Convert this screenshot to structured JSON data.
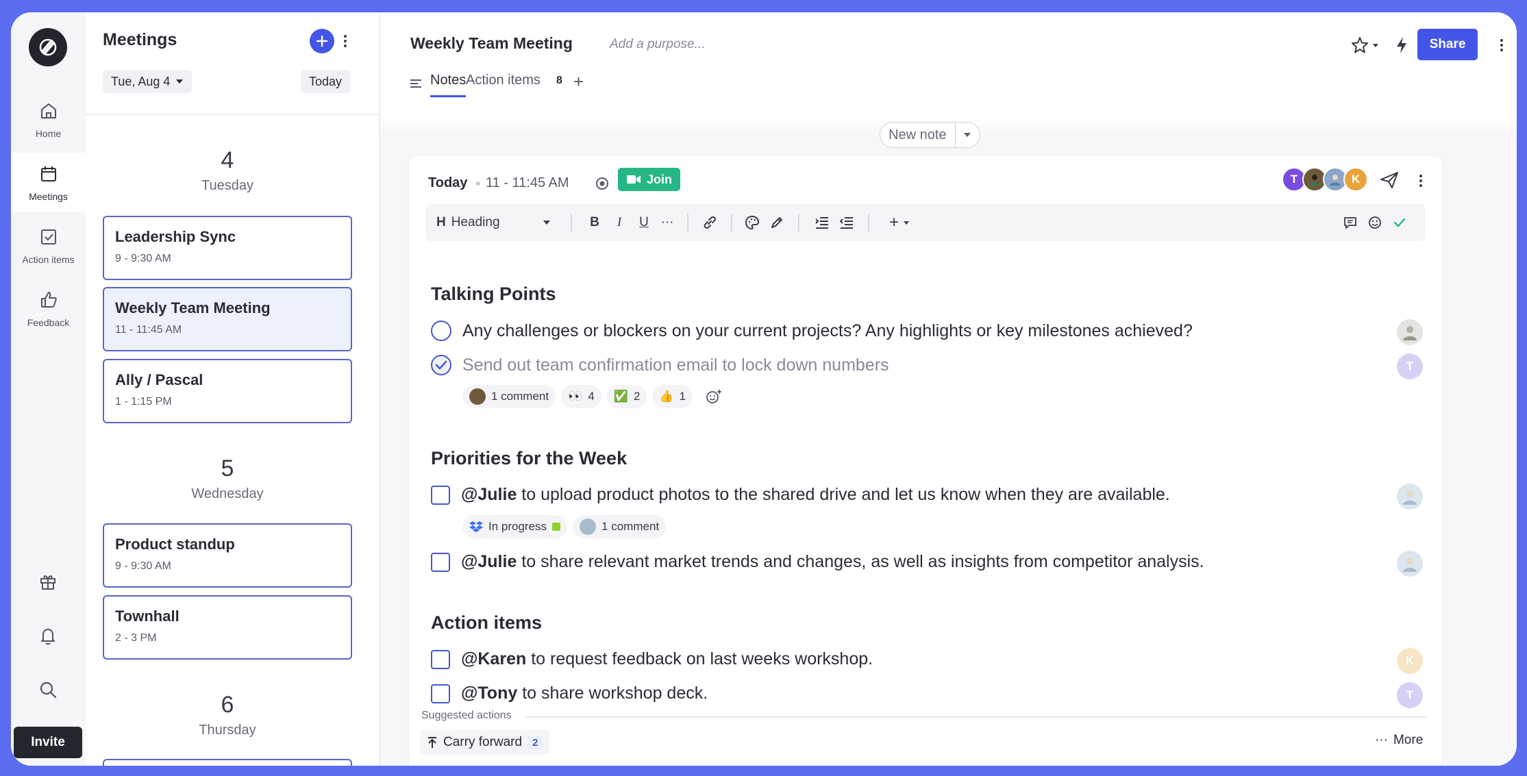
{
  "rail": {
    "items": [
      {
        "label": "Home",
        "icon": "home-icon"
      },
      {
        "label": "Meetings",
        "icon": "calendar-icon"
      },
      {
        "label": "Action items",
        "icon": "checkbox-icon"
      },
      {
        "label": "Feedback",
        "icon": "thumbs-up-icon"
      }
    ],
    "invite_label": "Invite"
  },
  "list": {
    "title": "Meetings",
    "date_label": "Tue, Aug 4",
    "today_label": "Today",
    "days": [
      {
        "num": "4",
        "name": "Tuesday"
      },
      {
        "num": "5",
        "name": "Wednesday"
      },
      {
        "num": "6",
        "name": "Thursday"
      }
    ],
    "meetings": [
      {
        "title": "Leadership Sync",
        "time": "9 - 9:30 AM"
      },
      {
        "title": "Weekly Team Meeting",
        "time": "11 - 11:45 AM"
      },
      {
        "title": "Ally / Pascal",
        "time": "1 - 1:15 PM"
      },
      {
        "title": "Product standup",
        "time": "9 - 9:30 AM"
      },
      {
        "title": "Townhall",
        "time": "2 - 3 PM"
      }
    ]
  },
  "header": {
    "title": "Weekly Team Meeting",
    "purpose_placeholder": "Add a purpose...",
    "share_label": "Share",
    "tabs": [
      {
        "label": "Notes"
      },
      {
        "label": "Action items",
        "count": "8"
      }
    ],
    "add_tab": "+"
  },
  "new_note_label": "New note",
  "note": {
    "day": "Today",
    "time": "11 - 11:45 AM",
    "join_label": "Join",
    "attendees": [
      {
        "initial": "T",
        "color": "#7b4ce0"
      },
      {
        "initial": "",
        "color": "#6e5a3a"
      },
      {
        "initial": "",
        "color": "#8aa6c8"
      },
      {
        "initial": "K",
        "color": "#e8a33a"
      }
    ],
    "toolbar": {
      "heading_label": "Heading"
    },
    "sections": [
      {
        "title": "Talking Points"
      },
      {
        "title": "Priorities for the Week"
      },
      {
        "title": "Action items"
      }
    ],
    "items": {
      "tp1": "Any challenges or blockers on your current projects? Any highlights or key milestones achieved?",
      "tp2": "Send out team confirmation email to lock down numbers",
      "tp2_comments": "1 comment",
      "tp2_reactions": [
        {
          "emoji": "👀",
          "count": "4"
        },
        {
          "emoji": "✅",
          "count": "2"
        },
        {
          "emoji": "👍",
          "count": "1"
        }
      ],
      "pr1_mention": "@Julie",
      "pr1_text": " to upload product photos to the shared drive and let us know when they are available.",
      "pr1_status": "In progress",
      "pr1_comments": "1 comment",
      "pr2_mention": "@Julie",
      "pr2_text": " to share relevant market trends and changes, as well as insights from competitor analysis.",
      "ai1_mention": "@Karen",
      "ai1_text": " to request feedback on last weeks workshop.",
      "ai2_mention": "@Tony",
      "ai2_text": " to share workshop deck."
    },
    "row_avatars": {
      "tp2": "T",
      "ai1": "K",
      "ai2": "T"
    },
    "suggested_label": "Suggested actions",
    "carry_label": "Carry forward",
    "carry_count": "2",
    "more_label": "More"
  },
  "colors": {
    "accent": "#4355e6",
    "join": "#25b883",
    "frame": "#5B6CF0"
  }
}
